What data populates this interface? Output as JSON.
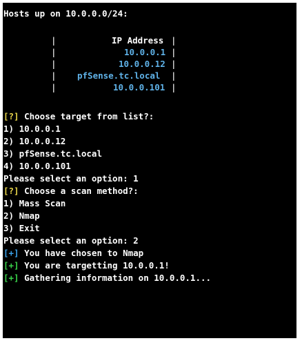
{
  "header": "Hosts up on 10.0.0.0/24:",
  "table": {
    "column_header": "IP Address",
    "rows": [
      "10.0.0.1",
      "10.0.0.12",
      "pfSense.tc.local",
      "10.0.0.101"
    ]
  },
  "target_prompt": {
    "marker": "[?]",
    "text": " Choose target from list?:",
    "options": [
      "1) 10.0.0.1",
      "2) 10.0.0.12",
      "3) pfSense.tc.local",
      "4) 10.0.0.101"
    ],
    "selection": "Please select an option: 1"
  },
  "scan_prompt": {
    "marker": "[?]",
    "text": " Choose a scan method?:",
    "options": [
      "1) Mass Scan",
      "2) Nmap",
      "3) Exit"
    ],
    "selection": "Please select an option: 2"
  },
  "messages": [
    {
      "marker": "[+]",
      "text": " You have chosen to Nmap",
      "color": "#3aa0e8"
    },
    {
      "marker": "[+]",
      "text": " You are targetting 10.0.0.1!",
      "color": "#39d24a"
    },
    {
      "marker": "[+]",
      "text": " Gathering information on 10.0.0.1...",
      "color": "#39d24a"
    }
  ],
  "colors": {
    "background": "#000000",
    "text": "#ffffff",
    "question_marker": "#e8d44a",
    "success_marker": "#39d24a",
    "info_marker": "#3aa0e8",
    "table_text": "#5fb2e8"
  }
}
